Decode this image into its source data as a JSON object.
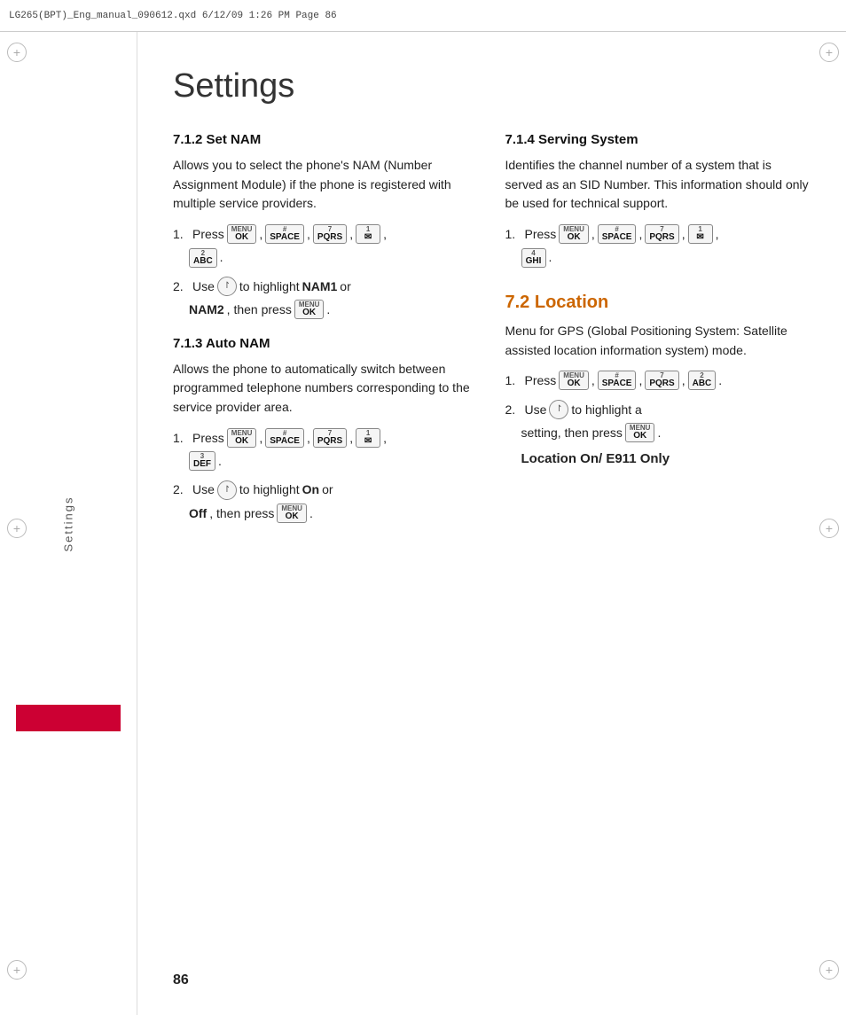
{
  "header": {
    "text": "LG265(BPT)_Eng_manual_090612.qxd   6/12/09   1:26 PM   Page 86"
  },
  "sidebar": {
    "label": "Settings"
  },
  "page_title": "Settings",
  "left_col": {
    "section712": {
      "heading": "7.1.2 Set NAM",
      "description": "Allows you to select the phone's NAM (Number Assignment Module) if the phone is registered with multiple service providers.",
      "step1_label": "1. Press",
      "step1_keys": [
        "MENU/OK",
        "#SPACE",
        "7PQRS",
        "1⁻",
        "2ABC"
      ],
      "step2_label": "2. Use",
      "step2_text1": "to highlight",
      "step2_bold1": "NAM1",
      "step2_text2": "or",
      "step2_bold2": "NAM2",
      "step2_text3": ", then press",
      "step2_key": "MENU/OK"
    },
    "section713": {
      "heading": "7.1.3 Auto NAM",
      "description": "Allows the phone to automatically switch between programmed telephone numbers corresponding to the service provider area.",
      "step1_label": "1. Press",
      "step1_keys": [
        "MENU/OK",
        "#SPACE",
        "7PQRS",
        "1⁻",
        "3DEF"
      ],
      "step2_label": "2. Use",
      "step2_text1": "to highlight",
      "step2_bold1": "On",
      "step2_text2": "or",
      "step2_bold2": "Off",
      "step2_text3": ", then press"
    }
  },
  "right_col": {
    "section714": {
      "heading": "7.1.4 Serving System",
      "description": "Identifies the channel number of a system that is served as an SID Number. This information should only be used for technical support.",
      "step1_label": "1. Press",
      "step1_keys": [
        "MENU/OK",
        "#SPACE",
        "7PQRS",
        "1⁻",
        "4GHI"
      ]
    },
    "section72": {
      "heading": "7.2 Location",
      "description": "Menu for GPS (Global Positioning System: Satellite assisted location information system) mode.",
      "step1_label": "1. Press",
      "step1_keys": [
        "MENU/OK",
        "#SPACE",
        "7PQRS",
        "2ABC"
      ],
      "step2_label": "2. Use",
      "step2_text1": "to highlight a setting, then press",
      "step2_key": "MENU/OK",
      "step2_bold": "Location On/ E911 Only"
    }
  },
  "page_number": "86",
  "keys": {
    "menu_ok": {
      "top": "MENU",
      "bottom": "OK"
    },
    "hash_space": {
      "top": "#",
      "bottom": "SPACE"
    },
    "seven_pqrs": {
      "top": "7",
      "bottom": "PQRS"
    },
    "one": {
      "top": "1",
      "bottom": ""
    },
    "two_abc": {
      "top": "2",
      "bottom": "ABC"
    },
    "three_def": {
      "top": "3",
      "bottom": "DEF"
    },
    "four_ghi": {
      "top": "4",
      "bottom": "GHI"
    }
  }
}
